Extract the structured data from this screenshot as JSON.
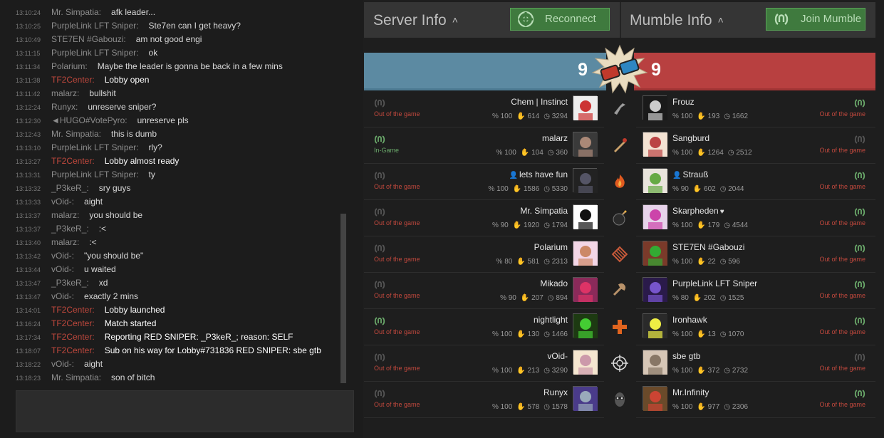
{
  "chat": {
    "messages": [
      {
        "time": "13:10:24",
        "user": "Mr. Simpatia:",
        "text": "afk leader...",
        "system": false
      },
      {
        "time": "13:10:25",
        "user": "PurpleLink LFT Sniper:",
        "text": "Ste7en can I get heavy?",
        "system": false
      },
      {
        "time": "13:10:49",
        "user": "STE7EN #Gabouzi:",
        "text": "am not good engi",
        "system": false
      },
      {
        "time": "13:11:15",
        "user": "PurpleLink LFT Sniper:",
        "text": "ok",
        "system": false
      },
      {
        "time": "13:11:34",
        "user": "Polarium:",
        "text": "Maybe the leader is gonna be back in a few mins",
        "system": false
      },
      {
        "time": "13:11:38",
        "user": "TF2Center:",
        "text": "Lobby open",
        "system": true
      },
      {
        "time": "13:11:42",
        "user": "malarz:",
        "text": "bullshit",
        "system": false
      },
      {
        "time": "13:12:24",
        "user": "Runyx:",
        "text": "unreserve sniper?",
        "system": false
      },
      {
        "time": "13:12:30",
        "user": "◄HUGO#VotePyro:",
        "text": "unreserve pls",
        "system": false
      },
      {
        "time": "13:12:43",
        "user": "Mr. Simpatia:",
        "text": "this is dumb",
        "system": false
      },
      {
        "time": "13:13:10",
        "user": "PurpleLink LFT Sniper:",
        "text": "rly?",
        "system": false
      },
      {
        "time": "13:13:27",
        "user": "TF2Center:",
        "text": "Lobby almost ready",
        "system": true
      },
      {
        "time": "13:13:31",
        "user": "PurpleLink LFT Sniper:",
        "text": "ty",
        "system": false
      },
      {
        "time": "13:13:32",
        "user": "_P3keR_:",
        "text": "sry guys",
        "system": false
      },
      {
        "time": "13:13:33",
        "user": "vOid-:",
        "text": "aight",
        "system": false
      },
      {
        "time": "13:13:37",
        "user": "malarz:",
        "text": "you should be",
        "system": false
      },
      {
        "time": "13:13:37",
        "user": "_P3keR_:",
        "text": ":<",
        "system": false
      },
      {
        "time": "13:13:40",
        "user": "malarz:",
        "text": ":<",
        "system": false
      },
      {
        "time": "13:13:42",
        "user": "vOid-:",
        "text": "\"you should be\"",
        "system": false
      },
      {
        "time": "13:13:44",
        "user": "vOid-:",
        "text": "u waited",
        "system": false
      },
      {
        "time": "13:13:47",
        "user": "_P3keR_:",
        "text": "xd",
        "system": false
      },
      {
        "time": "13:13:47",
        "user": "vOid-:",
        "text": "exactly 2 mins",
        "system": false
      },
      {
        "time": "13:14:01",
        "user": "TF2Center:",
        "text": "Lobby launched",
        "system": true
      },
      {
        "time": "13:16:24",
        "user": "TF2Center:",
        "text": "Match started",
        "system": true
      },
      {
        "time": "13:17:34",
        "user": "TF2Center:",
        "text": "Reporting RED SNIPER: _P3keR_; reason: SELF",
        "system": true
      },
      {
        "time": "13:18:07",
        "user": "TF2Center:",
        "text": "Sub on his way for Lobby#731836 RED SNIPER: sbe gtb",
        "system": true
      },
      {
        "time": "13:18:22",
        "user": "vOid-:",
        "text": "aight",
        "system": false
      },
      {
        "time": "13:18:23",
        "user": "Mr. Simpatia:",
        "text": "son of bitch",
        "system": false
      }
    ],
    "input_value": ""
  },
  "header": {
    "server_title": "Server Info",
    "reconnect_label": "Reconnect",
    "mumble_title": "Mumble Info",
    "join_mumble_label": "Join Mumble",
    "chevron": "^"
  },
  "score": {
    "blu": "9",
    "red": "9"
  },
  "colors": {
    "blu": "#5c8aa2",
    "red": "#b84040",
    "button_green": "#3f7a3e",
    "status_out": "#c0483d",
    "status_in": "#6aa86a"
  },
  "classes": [
    "scout-icon",
    "soldier-icon",
    "pyro-icon",
    "demoman-icon",
    "heavy-icon",
    "engineer-icon",
    "medic-icon",
    "sniper-icon",
    "spy-icon"
  ],
  "blu_players": [
    {
      "name": "Chem | Instinct",
      "status": "Out of the game",
      "in_game": false,
      "pct": "100",
      "games": "614",
      "hours": "3294",
      "leader": false
    },
    {
      "name": "malarz",
      "status": "In-Game",
      "in_game": true,
      "pct": "100",
      "games": "104",
      "hours": "360",
      "leader": false
    },
    {
      "name": "lets have fun",
      "status": "Out of the game",
      "in_game": false,
      "pct": "100",
      "games": "1586",
      "hours": "5330",
      "leader": true
    },
    {
      "name": "Mr. Simpatia",
      "status": "Out of the game",
      "in_game": false,
      "pct": "90",
      "games": "1920",
      "hours": "1794",
      "leader": false
    },
    {
      "name": "Polarium",
      "status": "Out of the game",
      "in_game": false,
      "pct": "80",
      "games": "581",
      "hours": "2313",
      "leader": false
    },
    {
      "name": "Mikado",
      "status": "Out of the game",
      "in_game": false,
      "pct": "90",
      "games": "207",
      "hours": "894",
      "leader": false
    },
    {
      "name": "nightlight",
      "status": "Out of the game",
      "in_game": true,
      "pct": "100",
      "games": "130",
      "hours": "1466",
      "leader": false
    },
    {
      "name": "vOid-",
      "status": "Out of the game",
      "in_game": false,
      "pct": "100",
      "games": "213",
      "hours": "3290",
      "leader": false
    },
    {
      "name": "Runyx",
      "status": "Out of the game",
      "in_game": false,
      "pct": "100",
      "games": "578",
      "hours": "1578",
      "leader": false
    }
  ],
  "red_players": [
    {
      "name": "Frouz",
      "status": "Out of the game",
      "in_game": true,
      "pct": "100",
      "games": "193",
      "hours": "1662",
      "leader": false,
      "heart": false
    },
    {
      "name": "Sangburd",
      "status": "Out of the game",
      "in_game": false,
      "pct": "100",
      "games": "1264",
      "hours": "2512",
      "leader": false,
      "heart": false
    },
    {
      "name": "Strauß",
      "status": "Out of the game",
      "in_game": true,
      "pct": "90",
      "games": "602",
      "hours": "2044",
      "leader": true,
      "heart": false
    },
    {
      "name": "Skarpheden",
      "status": "Out of the game",
      "in_game": true,
      "pct": "100",
      "games": "179",
      "hours": "4544",
      "leader": false,
      "heart": true
    },
    {
      "name": "STE7EN #Gabouzi",
      "status": "Out of the game",
      "in_game": true,
      "pct": "100",
      "games": "22",
      "hours": "596",
      "leader": false,
      "heart": false
    },
    {
      "name": "PurpleLink LFT Sniper",
      "status": "Out of the game",
      "in_game": true,
      "pct": "80",
      "games": "202",
      "hours": "1525",
      "leader": false,
      "heart": false
    },
    {
      "name": "Ironhawk",
      "status": "Out of the game",
      "in_game": true,
      "pct": "100",
      "games": "13",
      "hours": "1070",
      "leader": false,
      "heart": false
    },
    {
      "name": "sbe gtb",
      "status": "Out of the game",
      "in_game": false,
      "pct": "100",
      "games": "372",
      "hours": "2732",
      "leader": false,
      "heart": false
    },
    {
      "name": "Mr.Infinity",
      "status": "Out of the game",
      "in_game": true,
      "pct": "100",
      "games": "977",
      "hours": "2306",
      "leader": false,
      "heart": false
    }
  ]
}
